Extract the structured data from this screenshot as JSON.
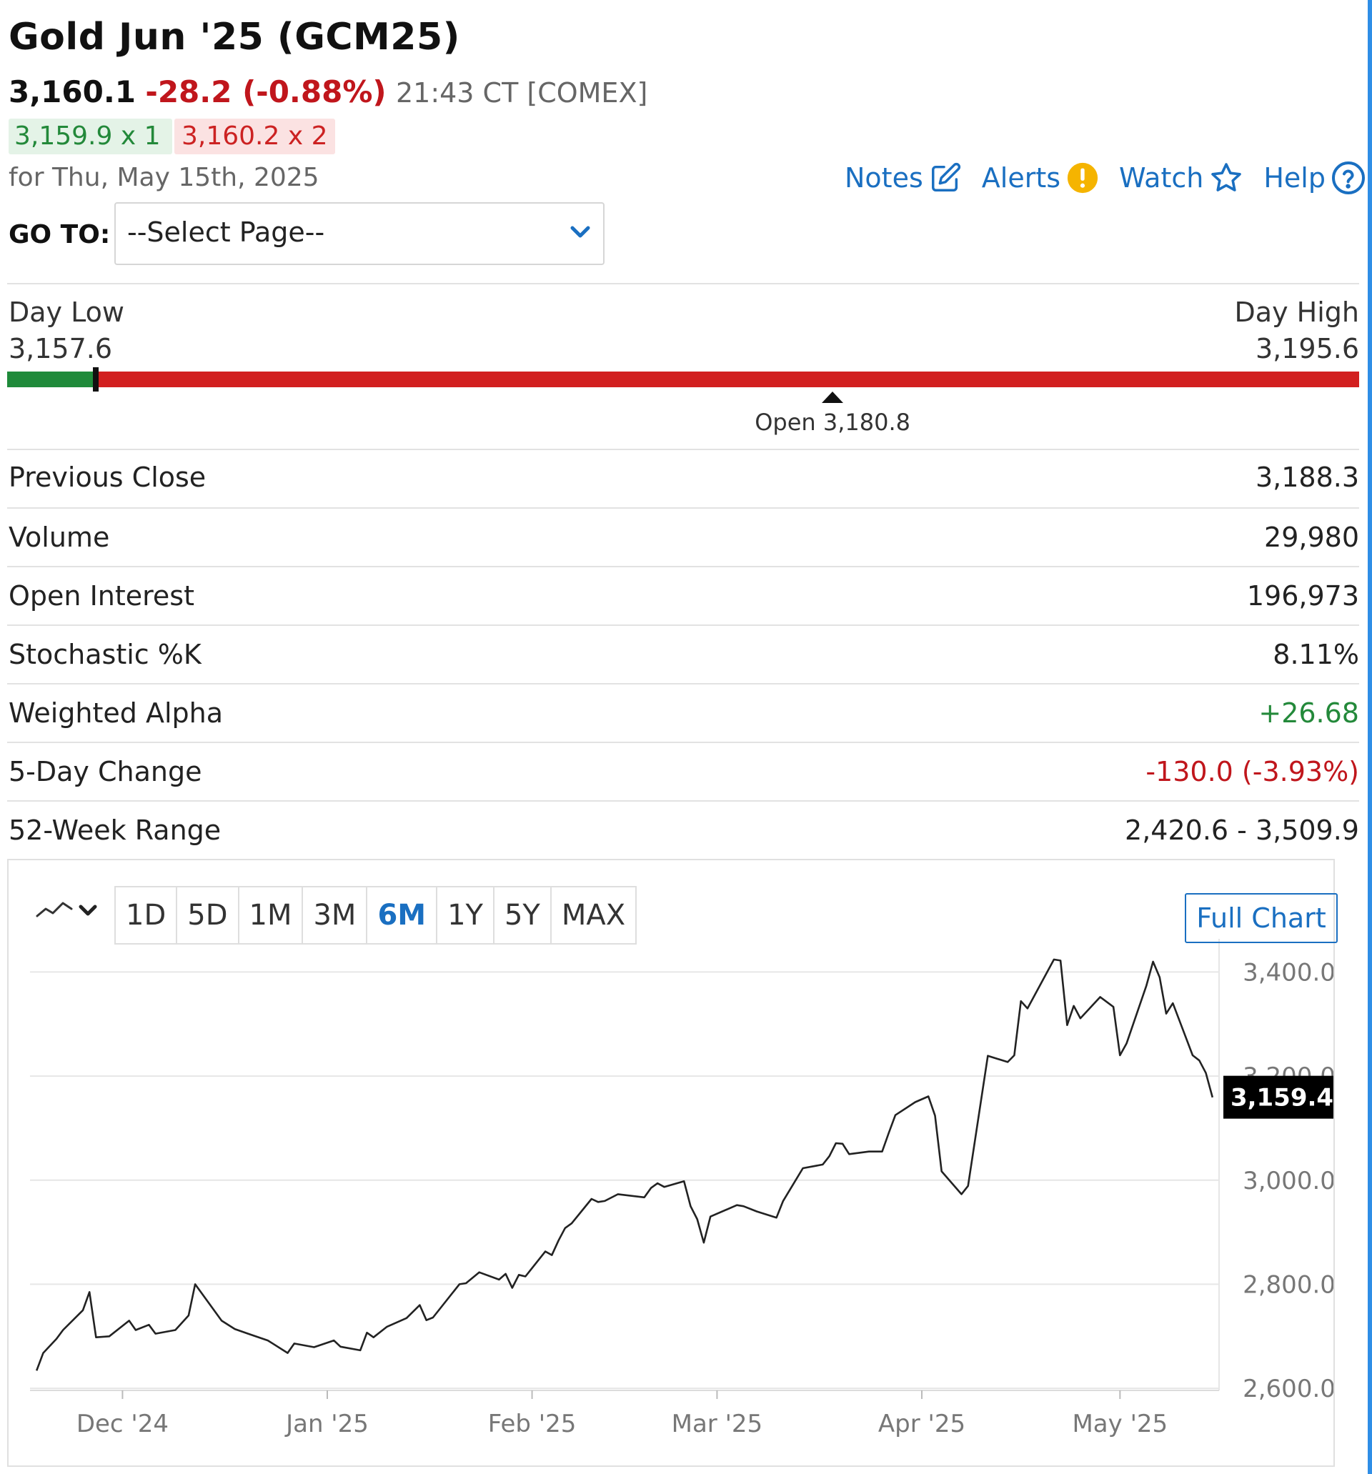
{
  "header": {
    "title": "Gold Jun '25 (GCM25)",
    "last": "3,160.1",
    "change": "-28.2 (-0.88%)",
    "time": "21:43 CT [COMEX]",
    "bid": "3,159.9 x 1",
    "ask": "3,160.2 x 2",
    "date": "for Thu, May 15th, 2025"
  },
  "actions": {
    "notes": "Notes",
    "alerts": "Alerts",
    "watch": "Watch",
    "help": "Help"
  },
  "goto": {
    "label": "GO TO:",
    "selected": "--Select Page--"
  },
  "day_range": {
    "low_label": "Day Low",
    "low_value": "3,157.6",
    "high_label": "Day High",
    "high_value": "3,195.6",
    "low": 3157.6,
    "high": 3195.6,
    "current": 3160.1,
    "open": 3180.8,
    "open_label": "Open 3,180.8"
  },
  "stats": [
    {
      "label": "Previous Close",
      "value": "3,188.3",
      "tone": ""
    },
    {
      "label": "Volume",
      "value": "29,980",
      "tone": ""
    },
    {
      "label": "Open Interest",
      "value": "196,973",
      "tone": ""
    },
    {
      "label": "Stochastic %K",
      "value": "8.11%",
      "tone": ""
    },
    {
      "label": "Weighted Alpha",
      "value": "+26.68",
      "tone": "pos"
    },
    {
      "label": "5-Day Change",
      "value": "-130.0 (-3.93%)",
      "tone": "neg"
    },
    {
      "label": "52-Week Range",
      "value": "2,420.6 - 3,509.9",
      "tone": ""
    }
  ],
  "chart_toolbar": {
    "chart_type_icon": "line-chart-icon",
    "periods": [
      "1D",
      "5D",
      "1M",
      "3M",
      "6M",
      "1Y",
      "5Y",
      "MAX"
    ],
    "active_period": "6M",
    "full_chart_label": "Full Chart"
  },
  "colors": {
    "link_blue": "#1a6fc1",
    "negative_red": "#c0161c",
    "positive_green": "#23893a",
    "range_red": "#d21f1f",
    "range_green": "#1f8a3a",
    "line": "#222222"
  },
  "chart_data": {
    "type": "line",
    "x_tick_labels": [
      "Dec '24",
      "Jan '25",
      "Feb '25",
      "Mar '25",
      "Apr '25",
      "May '25"
    ],
    "x_tick_dates": [
      "2024-12-01",
      "2025-01-01",
      "2025-02-01",
      "2025-03-01",
      "2025-04-01",
      "2025-05-01"
    ],
    "y_ticks": [
      2600,
      2800,
      3000,
      3200,
      3400
    ],
    "y_tick_labels": [
      "2,600.0",
      "2,800.0",
      "3,000.0",
      "3,200.0",
      "3,400.0"
    ],
    "ylim": [
      2596,
      3450
    ],
    "xlim": [
      "2024-11-17",
      "2025-05-16"
    ],
    "grid": true,
    "last_price_label": "3,159.4",
    "last_price": 3159.4,
    "series": [
      {
        "x": [
          "2024-11-18",
          "2024-11-19",
          "2024-11-21",
          "2024-11-22",
          "2024-11-25",
          "2024-11-26",
          "2024-11-27",
          "2024-11-29",
          "2024-12-02",
          "2024-12-03",
          "2024-12-05",
          "2024-12-06",
          "2024-12-09",
          "2024-12-11",
          "2024-12-12",
          "2024-12-16",
          "2024-12-18",
          "2024-12-20",
          "2024-12-23",
          "2024-12-26",
          "2024-12-27",
          "2024-12-30",
          "2025-01-02",
          "2025-01-03",
          "2025-01-06",
          "2025-01-07",
          "2025-01-08",
          "2025-01-10",
          "2025-01-13",
          "2025-01-15",
          "2025-01-16",
          "2025-01-17",
          "2025-01-21",
          "2025-01-22",
          "2025-01-24",
          "2025-01-27",
          "2025-01-28",
          "2025-01-29",
          "2025-01-30",
          "2025-01-31",
          "2025-02-03",
          "2025-02-04",
          "2025-02-05",
          "2025-02-06",
          "2025-02-07",
          "2025-02-10",
          "2025-02-11",
          "2025-02-12",
          "2025-02-14",
          "2025-02-18",
          "2025-02-19",
          "2025-02-20",
          "2025-02-21",
          "2025-02-24",
          "2025-02-25",
          "2025-02-26",
          "2025-02-27",
          "2025-02-28",
          "2025-03-04",
          "2025-03-05",
          "2025-03-07",
          "2025-03-10",
          "2025-03-11",
          "2025-03-14",
          "2025-03-17",
          "2025-03-18",
          "2025-03-19",
          "2025-03-20",
          "2025-03-21",
          "2025-03-24",
          "2025-03-26",
          "2025-03-27",
          "2025-03-28",
          "2025-03-31",
          "2025-04-02",
          "2025-04-03",
          "2025-04-04",
          "2025-04-07",
          "2025-04-08",
          "2025-04-11",
          "2025-04-14",
          "2025-04-15",
          "2025-04-16",
          "2025-04-17",
          "2025-04-21",
          "2025-04-22",
          "2025-04-23",
          "2025-04-24",
          "2025-04-25",
          "2025-04-28",
          "2025-04-30",
          "2025-05-01",
          "2025-05-02",
          "2025-05-05",
          "2025-05-06",
          "2025-05-07",
          "2025-05-08",
          "2025-05-09",
          "2025-05-12",
          "2025-05-13",
          "2025-05-14",
          "2025-05-15"
        ],
        "y": [
          2634,
          2668,
          2695,
          2712,
          2750,
          2785,
          2698,
          2700,
          2730,
          2712,
          2722,
          2705,
          2712,
          2740,
          2800,
          2730,
          2714,
          2705,
          2692,
          2668,
          2686,
          2679,
          2692,
          2680,
          2673,
          2707,
          2698,
          2718,
          2735,
          2760,
          2731,
          2736,
          2800,
          2802,
          2823,
          2809,
          2820,
          2793,
          2818,
          2815,
          2863,
          2856,
          2884,
          2908,
          2917,
          2964,
          2958,
          2960,
          2973,
          2967,
          2985,
          2994,
          2987,
          2998,
          2950,
          2925,
          2880,
          2930,
          2952,
          2950,
          2940,
          2928,
          2960,
          3023,
          3030,
          3046,
          3071,
          3070,
          3050,
          3055,
          3055,
          3091,
          3125,
          3150,
          3161,
          3124,
          3017,
          2973,
          2989,
          3239,
          3227,
          3240,
          3344,
          3330,
          3424,
          3422,
          3298,
          3335,
          3311,
          3352,
          3333,
          3240,
          3263,
          3374,
          3420,
          3390,
          3320,
          3340,
          3240,
          3230,
          3206,
          3159
        ]
      }
    ]
  }
}
